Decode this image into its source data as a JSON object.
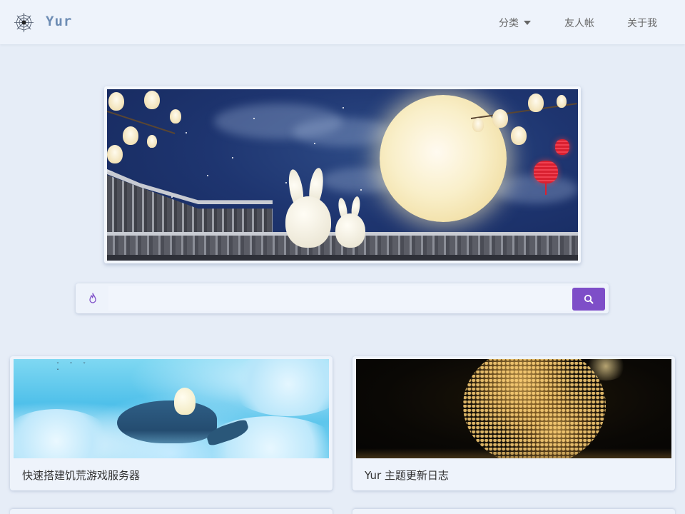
{
  "brand": {
    "name": "Yur",
    "logo_icon": "spiderweb-icon"
  },
  "nav": {
    "items": [
      {
        "label": "分类",
        "has_dropdown": true
      },
      {
        "label": "友人帐"
      },
      {
        "label": "关于我"
      }
    ]
  },
  "banner": {
    "alt_description_icon": "moon-festival-banner-image"
  },
  "search": {
    "left_icon": "flame-icon",
    "value": "",
    "placeholder": "",
    "button_icon": "search-icon",
    "button_color": "#7e4ec8"
  },
  "posts": [
    {
      "title": "快速搭建饥荒游戏服务器",
      "cover": "whale-cloud-illustration"
    },
    {
      "title": "Yur 主题更新日志",
      "cover": "golden-particle-earth"
    }
  ],
  "colors": {
    "page_bg": "#e6edf7",
    "nav_bg": "#eef3fb",
    "brand": "#6d8cb4",
    "accent": "#7e4ec8"
  }
}
